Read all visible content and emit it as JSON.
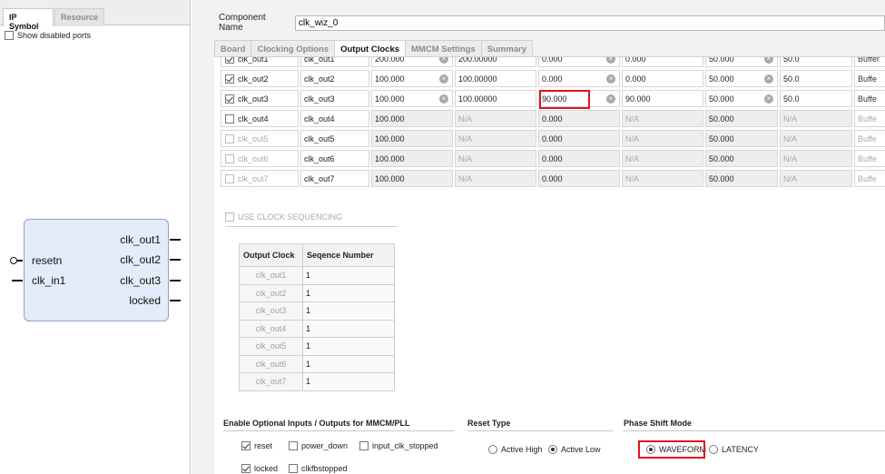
{
  "left_panel": {
    "tabs": [
      "IP Symbol",
      "Resource"
    ],
    "show_disabled_ports": "Show disabled ports",
    "symbol": {
      "outputs": [
        "clk_out1",
        "clk_out2",
        "clk_out3",
        "locked"
      ],
      "inputs": [
        "resetn",
        "clk_in1"
      ]
    }
  },
  "header": {
    "component_name_label": "Component Name",
    "component_name_value": "clk_wiz_0"
  },
  "tabs": [
    "Board",
    "Clocking Options",
    "Output Clocks",
    "MMCM Settings",
    "Summary"
  ],
  "active_tab": "Output Clocks",
  "clocks": [
    {
      "name": "clk_out1",
      "enabled": true,
      "port": "clk_out1",
      "freq": "200.000",
      "actual_freq": "200.00000",
      "phase": "0.000",
      "actual_phase": "0.000",
      "duty": "50.000",
      "actual_duty": "50.0",
      "drives": "Buffer",
      "partial": true
    },
    {
      "name": "clk_out2",
      "enabled": true,
      "port": "clk_out2",
      "freq": "100.000",
      "actual_freq": "100.00000",
      "phase": "0.000",
      "actual_phase": "0.000",
      "duty": "50.000",
      "actual_duty": "50.0",
      "drives": "Buffe"
    },
    {
      "name": "clk_out3",
      "enabled": true,
      "port": "clk_out3",
      "freq": "100.000",
      "actual_freq": "100.00000",
      "phase": "90.000",
      "actual_phase": "90.000",
      "duty": "50.000",
      "actual_duty": "50.0",
      "drives": "Buffe"
    },
    {
      "name": "clk_out4",
      "enabled": false,
      "port": "clk_out4",
      "freq": "100.000",
      "actual_freq": "N/A",
      "phase": "0.000",
      "actual_phase": "N/A",
      "duty": "50.000",
      "actual_duty": "N/A",
      "drives": "Buffe"
    },
    {
      "name": "clk_out5",
      "enabled": false,
      "port": "clk_out5",
      "freq": "100.000",
      "actual_freq": "N/A",
      "phase": "0.000",
      "actual_phase": "N/A",
      "duty": "50.000",
      "actual_duty": "N/A",
      "drives": "Buffe"
    },
    {
      "name": "clk_out6",
      "enabled": false,
      "port": "clk_out6",
      "freq": "100.000",
      "actual_freq": "N/A",
      "phase": "0.000",
      "actual_phase": "N/A",
      "duty": "50.000",
      "actual_duty": "N/A",
      "drives": "Buffe"
    },
    {
      "name": "clk_out7",
      "enabled": false,
      "port": "clk_out7",
      "freq": "100.000",
      "actual_freq": "N/A",
      "phase": "0.000",
      "actual_phase": "N/A",
      "duty": "50.000",
      "actual_duty": "N/A",
      "drives": "Buffe"
    }
  ],
  "use_clock_sequencing": "USE CLOCK SEQUENCING",
  "sequence_table": {
    "headers": [
      "Output Clock",
      "Seqence Number"
    ],
    "rows": [
      [
        "clk_out1",
        "1"
      ],
      [
        "clk_out2",
        "1"
      ],
      [
        "clk_out3",
        "1"
      ],
      [
        "clk_out4",
        "1"
      ],
      [
        "clk_out5",
        "1"
      ],
      [
        "clk_out6",
        "1"
      ],
      [
        "clk_out7",
        "1"
      ]
    ]
  },
  "optional_io": {
    "title": "Enable Optional Inputs / Outputs for MMCM/PLL",
    "reset": "reset",
    "power_down": "power_down",
    "input_clk_stopped": "input_clk_stopped",
    "locked": "locked",
    "clkfbstopped": "clkfbstopped"
  },
  "reset_type": {
    "title": "Reset Type",
    "active_high": "Active High",
    "active_low": "Active Low",
    "selected": "Active Low"
  },
  "phase_shift_mode": {
    "title": "Phase Shift Mode",
    "waveform": "WAVEFORM",
    "latency": "LATENCY",
    "selected": "WAVEFORM"
  },
  "colors": {
    "highlight": "#e0141e",
    "symbol_fill": "#e3ecf8"
  }
}
